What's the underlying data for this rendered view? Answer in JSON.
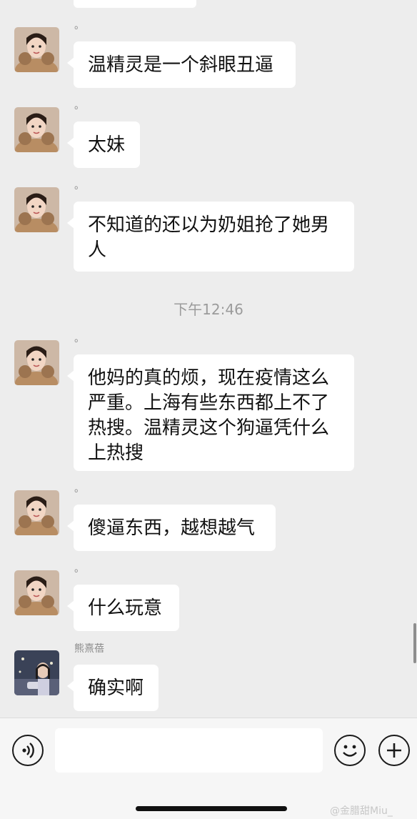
{
  "messages": [
    {
      "sender": "。",
      "text": "温精灵是一个斜眼丑逼"
    },
    {
      "sender": "。",
      "text": "太妹"
    },
    {
      "sender": "。",
      "text": "不知道的还以为奶姐抢了她男人"
    },
    {
      "sender": "。",
      "text": "他妈的真的烦，现在疫情这么严重。上海有些东西都上不了热搜。温精灵这个狗逼凭什么上热搜"
    },
    {
      "sender": "。",
      "text": "傻逼东西，越想越气"
    },
    {
      "sender": "。",
      "text": "什么玩意"
    },
    {
      "sender": "熊熹蓓",
      "text": "确实啊"
    }
  ],
  "timestamp": "下午12:46",
  "input": {
    "value": "",
    "placeholder": ""
  },
  "icons": {
    "voice": "voice-icon",
    "emoji": "emoji-icon",
    "plus": "plus-icon"
  },
  "watermark": "@金腊甜Miu_",
  "colors": {
    "background": "#ededed",
    "bubble": "#ffffff",
    "text": "#111111",
    "meta": "#9b9b9b"
  }
}
